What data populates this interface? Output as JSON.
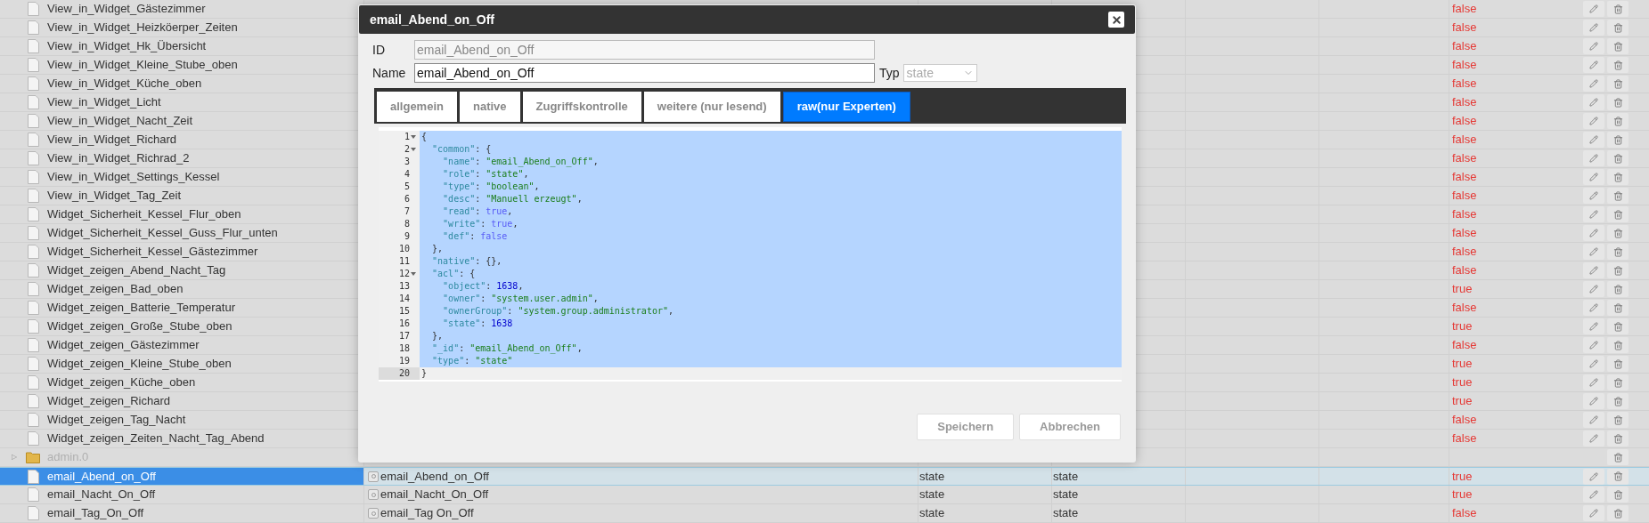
{
  "rows": [
    {
      "kind": "file",
      "name": "View_in_Widget_Gästezimmer",
      "value": "false"
    },
    {
      "kind": "file",
      "name": "View_in_Widget_Heizköerper_Zeiten",
      "value": "false"
    },
    {
      "kind": "file",
      "name": "View_in_Widget_Hk_Übersicht",
      "value": "false"
    },
    {
      "kind": "file",
      "name": "View_in_Widget_Kleine_Stube_oben",
      "value": "false"
    },
    {
      "kind": "file",
      "name": "View_in_Widget_Küche_oben",
      "value": "false"
    },
    {
      "kind": "file",
      "name": "View_in_Widget_Licht",
      "value": "false"
    },
    {
      "kind": "file",
      "name": "View_in_Widget_Nacht_Zeit",
      "value": "false"
    },
    {
      "kind": "file",
      "name": "View_in_Widget_Richard",
      "value": "false"
    },
    {
      "kind": "file",
      "name": "View_in_Widget_Richrad_2",
      "value": "false"
    },
    {
      "kind": "file",
      "name": "View_in_Widget_Settings_Kessel",
      "value": "false"
    },
    {
      "kind": "file",
      "name": "View_in_Widget_Tag_Zeit",
      "value": "false"
    },
    {
      "kind": "file",
      "name": "Widget_Sicherheit_Kessel_Flur_oben",
      "value": "false"
    },
    {
      "kind": "file",
      "name": "Widget_Sicherheit_Kessel_Guss_Flur_unten",
      "value": "false"
    },
    {
      "kind": "file",
      "name": "Widget_Sicherheit_Kessel_Gästezimmer",
      "value": "false"
    },
    {
      "kind": "file",
      "name": "Widget_zeigen_Abend_Nacht_Tag",
      "value": "false"
    },
    {
      "kind": "file",
      "name": "Widget_zeigen_Bad_oben",
      "value": "true"
    },
    {
      "kind": "file",
      "name": "Widget_zeigen_Batterie_Temperatur",
      "value": "false"
    },
    {
      "kind": "file",
      "name": "Widget_zeigen_Große_Stube_oben",
      "value": "true"
    },
    {
      "kind": "file",
      "name": "Widget_zeigen_Gästezimmer",
      "value": "false"
    },
    {
      "kind": "file",
      "name": "Widget_zeigen_Kleine_Stube_oben",
      "value": "true"
    },
    {
      "kind": "file",
      "name": "Widget_zeigen_Küche_oben",
      "value": "true"
    },
    {
      "kind": "file",
      "name": "Widget_zeigen_Richard",
      "value": "true"
    },
    {
      "kind": "file",
      "name": "Widget_zeigen_Tag_Nacht",
      "value": "false"
    },
    {
      "kind": "file",
      "name": "Widget_zeigen_Zeiten_Nacht_Tag_Abend",
      "value": "false"
    },
    {
      "kind": "folder",
      "expander": "▷",
      "name": "admin.0",
      "selected": false
    },
    {
      "kind": "file",
      "name": "email_Abend_on_Off",
      "id": "email_Abend_on_Off",
      "type": "state",
      "role": "state",
      "value": "true",
      "selected": true
    },
    {
      "kind": "file",
      "name": "email_Nacht_On_Off",
      "id": "email_Nacht_On_Off",
      "type": "state",
      "role": "state",
      "value": "true",
      "selected": false
    },
    {
      "kind": "file",
      "name": "email_Tag_On_Off",
      "id": "email_Tag On_Off",
      "type": "state",
      "role": "state",
      "value": "false",
      "selected": false
    }
  ],
  "dialog": {
    "title": "email_Abend_on_Off",
    "id_label": "ID",
    "id_value": "email_Abend_on_Off",
    "name_label": "Name",
    "name_value": "email_Abend_on_Off",
    "type_label": "Typ",
    "type_value": "state",
    "tabs": [
      {
        "label": "allgemein",
        "selected": false
      },
      {
        "label": "native",
        "selected": false
      },
      {
        "label": "Zugriffskontrolle",
        "selected": false
      },
      {
        "label": "weitere (nur lesend)",
        "selected": false
      },
      {
        "label": "raw(nur Experten)",
        "selected": true
      }
    ],
    "code_lines": [
      {
        "number": "1",
        "fold": true,
        "selected": true,
        "text": "{"
      },
      {
        "number": "2",
        "fold": true,
        "selected": true,
        "text": "  \"common\": {"
      },
      {
        "number": "3",
        "fold": false,
        "selected": true,
        "text": "    \"name\": \"email_Abend_on_Off\","
      },
      {
        "number": "4",
        "fold": false,
        "selected": true,
        "text": "    \"role\": \"state\","
      },
      {
        "number": "5",
        "fold": false,
        "selected": true,
        "text": "    \"type\": \"boolean\","
      },
      {
        "number": "6",
        "fold": false,
        "selected": true,
        "text": "    \"desc\": \"Manuell erzeugt\","
      },
      {
        "number": "7",
        "fold": false,
        "selected": true,
        "text": "    \"read\": true,"
      },
      {
        "number": "8",
        "fold": false,
        "selected": true,
        "text": "    \"write\": true,"
      },
      {
        "number": "9",
        "fold": false,
        "selected": true,
        "text": "    \"def\": false"
      },
      {
        "number": "10",
        "fold": false,
        "selected": true,
        "text": "  },"
      },
      {
        "number": "11",
        "fold": false,
        "selected": true,
        "text": "  \"native\": {},"
      },
      {
        "number": "12",
        "fold": true,
        "selected": true,
        "text": "  \"acl\": {"
      },
      {
        "number": "13",
        "fold": false,
        "selected": true,
        "text": "    \"object\": 1638,"
      },
      {
        "number": "14",
        "fold": false,
        "selected": true,
        "text": "    \"owner\": \"system.user.admin\","
      },
      {
        "number": "15",
        "fold": false,
        "selected": true,
        "text": "    \"ownerGroup\": \"system.group.administrator\","
      },
      {
        "number": "16",
        "fold": false,
        "selected": true,
        "text": "    \"state\": 1638"
      },
      {
        "number": "17",
        "fold": false,
        "selected": true,
        "text": "  },"
      },
      {
        "number": "18",
        "fold": false,
        "selected": true,
        "text": "  \"_id\": \"email_Abend_on_Off\","
      },
      {
        "number": "19",
        "fold": false,
        "selected": true,
        "text": "  \"type\": \"state\""
      },
      {
        "number": "20",
        "fold": false,
        "selected": false,
        "text": "}"
      }
    ],
    "buttons": [
      "Speichern",
      "Abbrechen"
    ]
  }
}
